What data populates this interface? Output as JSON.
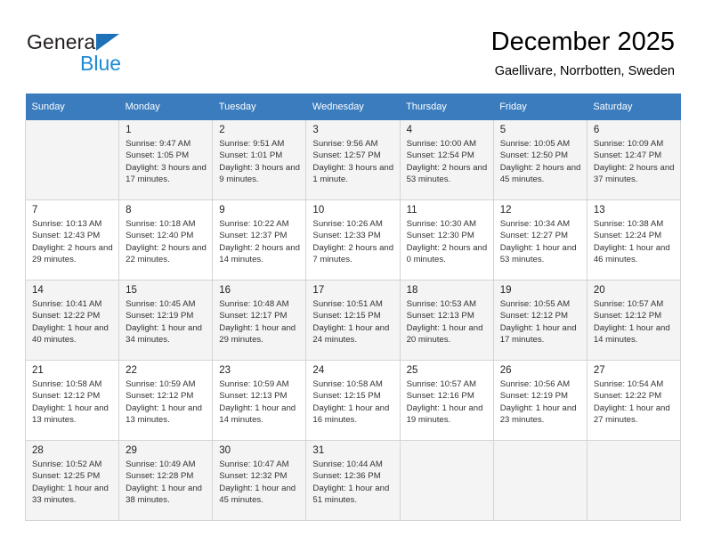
{
  "brand": {
    "line1": "General",
    "line2": "Blue",
    "triangle_color": "#1d71b8",
    "blue_color": "#1d8ad6"
  },
  "header": {
    "title": "December 2025",
    "subtitle": "Gaellivare, Norrbotten, Sweden"
  },
  "calendar": {
    "header_bg": "#3a7cbe",
    "shaded_row_bg": "#f4f4f4",
    "weekday_headers": [
      "Sunday",
      "Monday",
      "Tuesday",
      "Wednesday",
      "Thursday",
      "Friday",
      "Saturday"
    ],
    "labels": {
      "sunrise": "Sunrise:",
      "sunset": "Sunset:",
      "daylight": "Daylight:"
    },
    "weeks": [
      [
        {
          "day": "",
          "sunrise": "",
          "sunset": "",
          "daylight": ""
        },
        {
          "day": "1",
          "sunrise": "Sunrise: 9:47 AM",
          "sunset": "Sunset: 1:05 PM",
          "daylight": "Daylight: 3 hours and 17 minutes."
        },
        {
          "day": "2",
          "sunrise": "Sunrise: 9:51 AM",
          "sunset": "Sunset: 1:01 PM",
          "daylight": "Daylight: 3 hours and 9 minutes."
        },
        {
          "day": "3",
          "sunrise": "Sunrise: 9:56 AM",
          "sunset": "Sunset: 12:57 PM",
          "daylight": "Daylight: 3 hours and 1 minute."
        },
        {
          "day": "4",
          "sunrise": "Sunrise: 10:00 AM",
          "sunset": "Sunset: 12:54 PM",
          "daylight": "Daylight: 2 hours and 53 minutes."
        },
        {
          "day": "5",
          "sunrise": "Sunrise: 10:05 AM",
          "sunset": "Sunset: 12:50 PM",
          "daylight": "Daylight: 2 hours and 45 minutes."
        },
        {
          "day": "6",
          "sunrise": "Sunrise: 10:09 AM",
          "sunset": "Sunset: 12:47 PM",
          "daylight": "Daylight: 2 hours and 37 minutes."
        }
      ],
      [
        {
          "day": "7",
          "sunrise": "Sunrise: 10:13 AM",
          "sunset": "Sunset: 12:43 PM",
          "daylight": "Daylight: 2 hours and 29 minutes."
        },
        {
          "day": "8",
          "sunrise": "Sunrise: 10:18 AM",
          "sunset": "Sunset: 12:40 PM",
          "daylight": "Daylight: 2 hours and 22 minutes."
        },
        {
          "day": "9",
          "sunrise": "Sunrise: 10:22 AM",
          "sunset": "Sunset: 12:37 PM",
          "daylight": "Daylight: 2 hours and 14 minutes."
        },
        {
          "day": "10",
          "sunrise": "Sunrise: 10:26 AM",
          "sunset": "Sunset: 12:33 PM",
          "daylight": "Daylight: 2 hours and 7 minutes."
        },
        {
          "day": "11",
          "sunrise": "Sunrise: 10:30 AM",
          "sunset": "Sunset: 12:30 PM",
          "daylight": "Daylight: 2 hours and 0 minutes."
        },
        {
          "day": "12",
          "sunrise": "Sunrise: 10:34 AM",
          "sunset": "Sunset: 12:27 PM",
          "daylight": "Daylight: 1 hour and 53 minutes."
        },
        {
          "day": "13",
          "sunrise": "Sunrise: 10:38 AM",
          "sunset": "Sunset: 12:24 PM",
          "daylight": "Daylight: 1 hour and 46 minutes."
        }
      ],
      [
        {
          "day": "14",
          "sunrise": "Sunrise: 10:41 AM",
          "sunset": "Sunset: 12:22 PM",
          "daylight": "Daylight: 1 hour and 40 minutes."
        },
        {
          "day": "15",
          "sunrise": "Sunrise: 10:45 AM",
          "sunset": "Sunset: 12:19 PM",
          "daylight": "Daylight: 1 hour and 34 minutes."
        },
        {
          "day": "16",
          "sunrise": "Sunrise: 10:48 AM",
          "sunset": "Sunset: 12:17 PM",
          "daylight": "Daylight: 1 hour and 29 minutes."
        },
        {
          "day": "17",
          "sunrise": "Sunrise: 10:51 AM",
          "sunset": "Sunset: 12:15 PM",
          "daylight": "Daylight: 1 hour and 24 minutes."
        },
        {
          "day": "18",
          "sunrise": "Sunrise: 10:53 AM",
          "sunset": "Sunset: 12:13 PM",
          "daylight": "Daylight: 1 hour and 20 minutes."
        },
        {
          "day": "19",
          "sunrise": "Sunrise: 10:55 AM",
          "sunset": "Sunset: 12:12 PM",
          "daylight": "Daylight: 1 hour and 17 minutes."
        },
        {
          "day": "20",
          "sunrise": "Sunrise: 10:57 AM",
          "sunset": "Sunset: 12:12 PM",
          "daylight": "Daylight: 1 hour and 14 minutes."
        }
      ],
      [
        {
          "day": "21",
          "sunrise": "Sunrise: 10:58 AM",
          "sunset": "Sunset: 12:12 PM",
          "daylight": "Daylight: 1 hour and 13 minutes."
        },
        {
          "day": "22",
          "sunrise": "Sunrise: 10:59 AM",
          "sunset": "Sunset: 12:12 PM",
          "daylight": "Daylight: 1 hour and 13 minutes."
        },
        {
          "day": "23",
          "sunrise": "Sunrise: 10:59 AM",
          "sunset": "Sunset: 12:13 PM",
          "daylight": "Daylight: 1 hour and 14 minutes."
        },
        {
          "day": "24",
          "sunrise": "Sunrise: 10:58 AM",
          "sunset": "Sunset: 12:15 PM",
          "daylight": "Daylight: 1 hour and 16 minutes."
        },
        {
          "day": "25",
          "sunrise": "Sunrise: 10:57 AM",
          "sunset": "Sunset: 12:16 PM",
          "daylight": "Daylight: 1 hour and 19 minutes."
        },
        {
          "day": "26",
          "sunrise": "Sunrise: 10:56 AM",
          "sunset": "Sunset: 12:19 PM",
          "daylight": "Daylight: 1 hour and 23 minutes."
        },
        {
          "day": "27",
          "sunrise": "Sunrise: 10:54 AM",
          "sunset": "Sunset: 12:22 PM",
          "daylight": "Daylight: 1 hour and 27 minutes."
        }
      ],
      [
        {
          "day": "28",
          "sunrise": "Sunrise: 10:52 AM",
          "sunset": "Sunset: 12:25 PM",
          "daylight": "Daylight: 1 hour and 33 minutes."
        },
        {
          "day": "29",
          "sunrise": "Sunrise: 10:49 AM",
          "sunset": "Sunset: 12:28 PM",
          "daylight": "Daylight: 1 hour and 38 minutes."
        },
        {
          "day": "30",
          "sunrise": "Sunrise: 10:47 AM",
          "sunset": "Sunset: 12:32 PM",
          "daylight": "Daylight: 1 hour and 45 minutes."
        },
        {
          "day": "31",
          "sunrise": "Sunrise: 10:44 AM",
          "sunset": "Sunset: 12:36 PM",
          "daylight": "Daylight: 1 hour and 51 minutes."
        },
        {
          "day": "",
          "sunrise": "",
          "sunset": "",
          "daylight": ""
        },
        {
          "day": "",
          "sunrise": "",
          "sunset": "",
          "daylight": ""
        },
        {
          "day": "",
          "sunrise": "",
          "sunset": "",
          "daylight": ""
        }
      ]
    ]
  }
}
